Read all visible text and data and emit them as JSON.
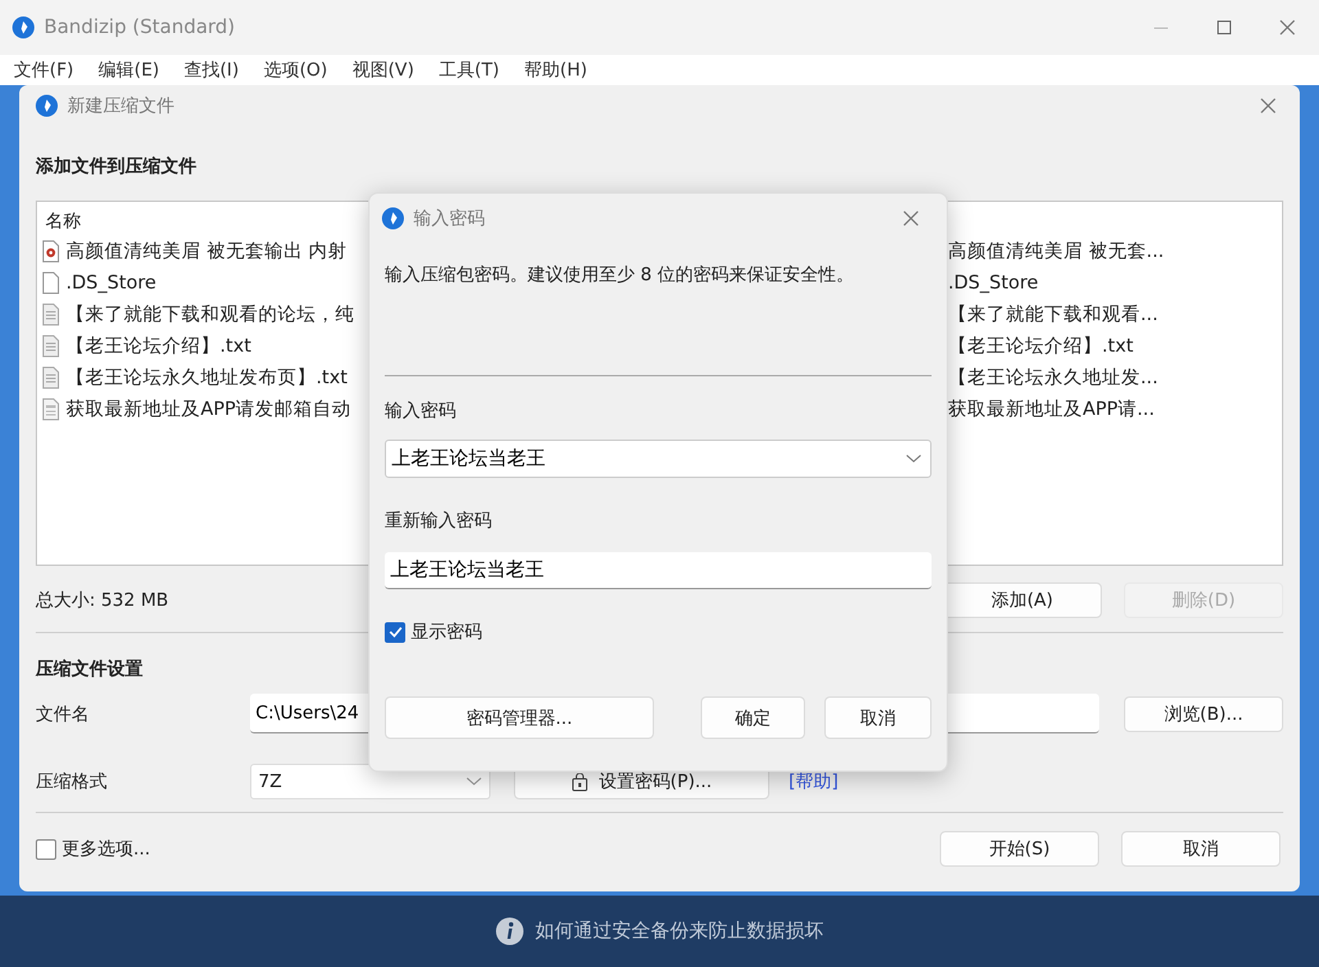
{
  "main_window": {
    "title": "Bandizip (Standard)",
    "menu": [
      "文件(F)",
      "编辑(E)",
      "查找(I)",
      "选项(O)",
      "视图(V)",
      "工具(T)",
      "帮助(H)"
    ]
  },
  "new_archive_dialog": {
    "title": "新建压缩文件",
    "section_title": "添加文件到压缩文件",
    "file_list": {
      "columns": [
        "名称"
      ],
      "rows": [
        {
          "kind": "video",
          "name": "高颜值清纯美眉 被无套输出 内射",
          "column_2": "高颜值清纯美眉 被无套..."
        },
        {
          "kind": "file",
          "name": ".DS_Store",
          "column_2": ".DS_Store"
        },
        {
          "kind": "text",
          "name": "【来了就能下载和观看的论坛，纯",
          "column_2": "【来了就能下载和观看..."
        },
        {
          "kind": "text",
          "name": "【老王论坛介绍】.txt",
          "column_2": "【老王论坛介绍】.txt"
        },
        {
          "kind": "text",
          "name": "【老王论坛永久地址发布页】.txt",
          "column_2": "【老王论坛永久地址发..."
        },
        {
          "kind": "document",
          "name": "获取最新地址及APP请发邮箱自动",
          "column_2": "获取最新地址及APP请..."
        }
      ]
    },
    "total_size": "总大小: 532 MB",
    "list_buttons": [
      {
        "label": "添加(A)",
        "disabled": false
      },
      {
        "label": "删除(D)",
        "disabled": true
      }
    ],
    "settings": {
      "title": "压缩文件设置",
      "filename": {
        "label": "文件名",
        "value": "C:\\Users\\24"
      },
      "browse_button": "浏览(B)...",
      "format": {
        "label": "压缩格式",
        "value": "7Z"
      },
      "set_password_button": "设置密码(P)...",
      "help_link": "[帮助]"
    },
    "more_options": {
      "label": "更多选项...",
      "checked": false
    },
    "footer_buttons": [
      "开始(S)",
      "取消"
    ]
  },
  "info_bar": {
    "text": "如何通过安全备份来防止数据损坏"
  },
  "password_dialog": {
    "title": "输入密码",
    "description": "输入压缩包密码。建议使用至少 8 位的密码来保证安全性。",
    "password": {
      "label": "输入密码",
      "value": "上老王论坛当老王"
    },
    "confirm": {
      "label": "重新输入密码",
      "value": "上老王论坛当老王"
    },
    "show_password": {
      "label": "显示密码",
      "checked": true
    },
    "buttons": [
      {
        "kind": "manager",
        "label": "密码管理器..."
      },
      {
        "kind": "ok",
        "label": "确定"
      },
      {
        "kind": "cancel",
        "label": "取消"
      }
    ]
  }
}
